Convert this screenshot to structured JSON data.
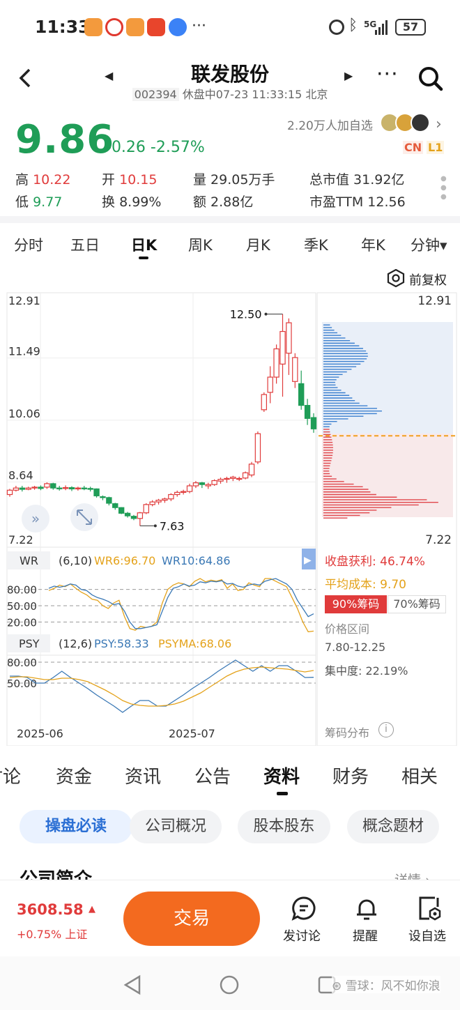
{
  "status_bar": {
    "time": "11:33",
    "network": "5G",
    "battery": "57"
  },
  "header": {
    "title": "联发股份",
    "code": "002394",
    "subtitle_rest": " 休盘中07-23 11:33:15 北京"
  },
  "quote": {
    "price": "9.86",
    "change": "-0.26 -2.57%",
    "followers": "2.20万人加自选",
    "badge_cn": "CN",
    "badge_l1": "L1",
    "high_label": "高",
    "high": "10.22",
    "low_label": "低",
    "low": "9.77",
    "open_label": "开",
    "open": "10.15",
    "turnover_label": "换",
    "turnover": "8.99%",
    "volume": "量 29.05万手",
    "amount": "额 2.88亿",
    "market_cap": "总市值 31.92亿",
    "pe": "市盈TTM 12.56"
  },
  "period_tabs": [
    "分时",
    "五日",
    "日K",
    "周K",
    "月K",
    "季K",
    "年K",
    "分钟▾"
  ],
  "chart": {
    "adjust_label": "前复权",
    "y_ticks": [
      "12.91",
      "11.49",
      "10.06",
      "8.64",
      "7.22"
    ],
    "max_label": "12.50",
    "min_label": "7.63",
    "x_ticks": [
      "2025-06",
      "2025-07"
    ],
    "wr": {
      "name": "WR",
      "params": "(6,10)",
      "wr6": "WR6:96.70",
      "wr10": "WR10:64.86",
      "levels": [
        "80.00",
        "50.00",
        "20.00"
      ]
    },
    "psy": {
      "name": "PSY",
      "params": "(12,6)",
      "psy": "PSY:58.33",
      "psyma": "PSYMA:68.06",
      "levels": [
        "80.00",
        "50.00"
      ]
    },
    "chips": {
      "profit_label": "收盘获利:",
      "profit": "46.74%",
      "avg_label": "平均成本:",
      "avg": "9.70",
      "btn90": "90%筹码",
      "btn70": "70%筹码",
      "range_label": "价格区间",
      "range": "7.80-12.25",
      "conc": "集中度: 22.19%",
      "dist_label": "筹码分布"
    }
  },
  "chart_data": {
    "type": "candlestick",
    "ylim": [
      7.22,
      12.91
    ],
    "candles": [
      [
        8.35,
        8.45,
        8.3,
        8.48
      ],
      [
        8.45,
        8.5,
        8.42,
        8.55
      ],
      [
        8.5,
        8.47,
        8.42,
        8.55
      ],
      [
        8.47,
        8.5,
        8.45,
        8.53
      ],
      [
        8.5,
        8.52,
        8.46,
        8.55
      ],
      [
        8.52,
        8.49,
        8.45,
        8.56
      ],
      [
        8.52,
        8.6,
        8.48,
        8.63
      ],
      [
        8.6,
        8.5,
        8.46,
        8.62
      ],
      [
        8.5,
        8.49,
        8.44,
        8.55
      ],
      [
        8.49,
        8.51,
        8.45,
        8.56
      ],
      [
        8.51,
        8.48,
        8.43,
        8.54
      ],
      [
        8.48,
        8.5,
        8.44,
        8.53
      ],
      [
        8.5,
        8.49,
        8.45,
        8.55
      ],
      [
        8.49,
        8.47,
        8.42,
        8.53
      ],
      [
        8.48,
        8.32,
        8.28,
        8.49
      ],
      [
        8.3,
        8.28,
        8.22,
        8.33
      ],
      [
        8.28,
        8.15,
        8.1,
        8.3
      ],
      [
        8.14,
        8.05,
        8.0,
        8.16
      ],
      [
        8.05,
        7.92,
        7.9,
        8.06
      ],
      [
        7.92,
        7.86,
        7.82,
        7.95
      ],
      [
        7.85,
        7.8,
        7.76,
        7.88
      ],
      [
        7.8,
        7.93,
        7.63,
        7.95
      ],
      [
        7.93,
        8.12,
        7.9,
        8.15
      ],
      [
        8.12,
        8.18,
        8.08,
        8.22
      ],
      [
        8.18,
        8.22,
        8.12,
        8.25
      ],
      [
        8.22,
        8.25,
        8.16,
        8.28
      ],
      [
        8.25,
        8.35,
        8.2,
        8.38
      ],
      [
        8.35,
        8.4,
        8.3,
        8.44
      ],
      [
        8.4,
        8.42,
        8.35,
        8.46
      ],
      [
        8.42,
        8.55,
        8.38,
        8.6
      ],
      [
        8.55,
        8.62,
        8.5,
        8.66
      ],
      [
        8.62,
        8.58,
        8.5,
        8.64
      ],
      [
        8.55,
        8.58,
        8.48,
        8.62
      ],
      [
        8.58,
        8.67,
        8.55,
        8.7
      ],
      [
        8.66,
        8.7,
        8.6,
        8.74
      ],
      [
        8.7,
        8.72,
        8.62,
        8.76
      ],
      [
        8.72,
        8.75,
        8.66,
        8.78
      ],
      [
        8.72,
        8.72,
        8.66,
        8.76
      ],
      [
        8.73,
        8.85,
        8.7,
        8.88
      ],
      [
        8.8,
        9.05,
        8.75,
        9.1
      ],
      [
        9.1,
        9.75,
        9.05,
        9.8
      ],
      [
        10.3,
        10.65,
        10.25,
        10.7
      ],
      [
        10.7,
        11.05,
        10.45,
        11.3
      ],
      [
        11.05,
        11.7,
        10.9,
        11.8
      ],
      [
        11.35,
        12.1,
        10.6,
        12.5
      ],
      [
        11.6,
        12.3,
        11.1,
        12.4
      ],
      [
        10.95,
        11.5,
        10.8,
        11.6
      ],
      [
        10.9,
        10.4,
        10.3,
        11.2
      ],
      [
        10.4,
        10.1,
        9.95,
        10.55
      ],
      [
        10.12,
        9.86,
        9.77,
        10.22
      ]
    ],
    "wr6": [
      22,
      18,
      12,
      15,
      10,
      18,
      25,
      30,
      38,
      40,
      50,
      55,
      45,
      40,
      70,
      92,
      95,
      88,
      90,
      88,
      80,
      45,
      20,
      12,
      8,
      10,
      15,
      5,
      0,
      6,
      3,
      5,
      2,
      18,
      10,
      22,
      20,
      8,
      12,
      15,
      0,
      0,
      5,
      10,
      15,
      35,
      55,
      80,
      98,
      96.7
    ],
    "wr10": [
      18,
      14,
      16,
      14,
      10,
      12,
      20,
      22,
      30,
      35,
      38,
      42,
      48,
      46,
      60,
      80,
      92,
      92,
      90,
      88,
      85,
      60,
      35,
      18,
      15,
      10,
      14,
      12,
      6,
      8,
      5,
      6,
      4,
      10,
      9,
      14,
      16,
      12,
      10,
      12,
      5,
      2,
      0,
      5,
      10,
      20,
      40,
      55,
      70,
      64.86
    ],
    "psy": [
      60,
      60,
      58,
      50,
      50,
      58,
      67,
      58,
      50,
      42,
      33,
      25,
      17,
      8,
      17,
      25,
      25,
      17,
      17,
      25,
      33,
      42,
      50,
      58,
      67,
      75,
      83,
      75,
      67,
      75,
      67,
      75,
      75,
      67,
      58,
      58.33
    ],
    "psyma": [
      58,
      59,
      59,
      57,
      55,
      55,
      57,
      57,
      55,
      52,
      46,
      40,
      33,
      25,
      20,
      18,
      17,
      17,
      18,
      20,
      24,
      30,
      36,
      44,
      52,
      60,
      66,
      70,
      72,
      73,
      72,
      71,
      70,
      68,
      66,
      68.06
    ]
  },
  "sections": {
    "tabs": [
      "讨论",
      "资金",
      "资讯",
      "公告",
      "资料",
      "财务",
      "相关"
    ],
    "active": "资料",
    "pills": [
      "操盘必读",
      "公司概况",
      "股本股东",
      "概念题材"
    ],
    "section_title": "公司简介",
    "detail": "详情 ›"
  },
  "bottom": {
    "index_value": "3608.58",
    "index_change": "+0.75% 上证",
    "trade": "交易",
    "discuss": "发讨论",
    "alert": "提醒",
    "watch": "设自选"
  },
  "watermark": "雪球：风不如你浪"
}
